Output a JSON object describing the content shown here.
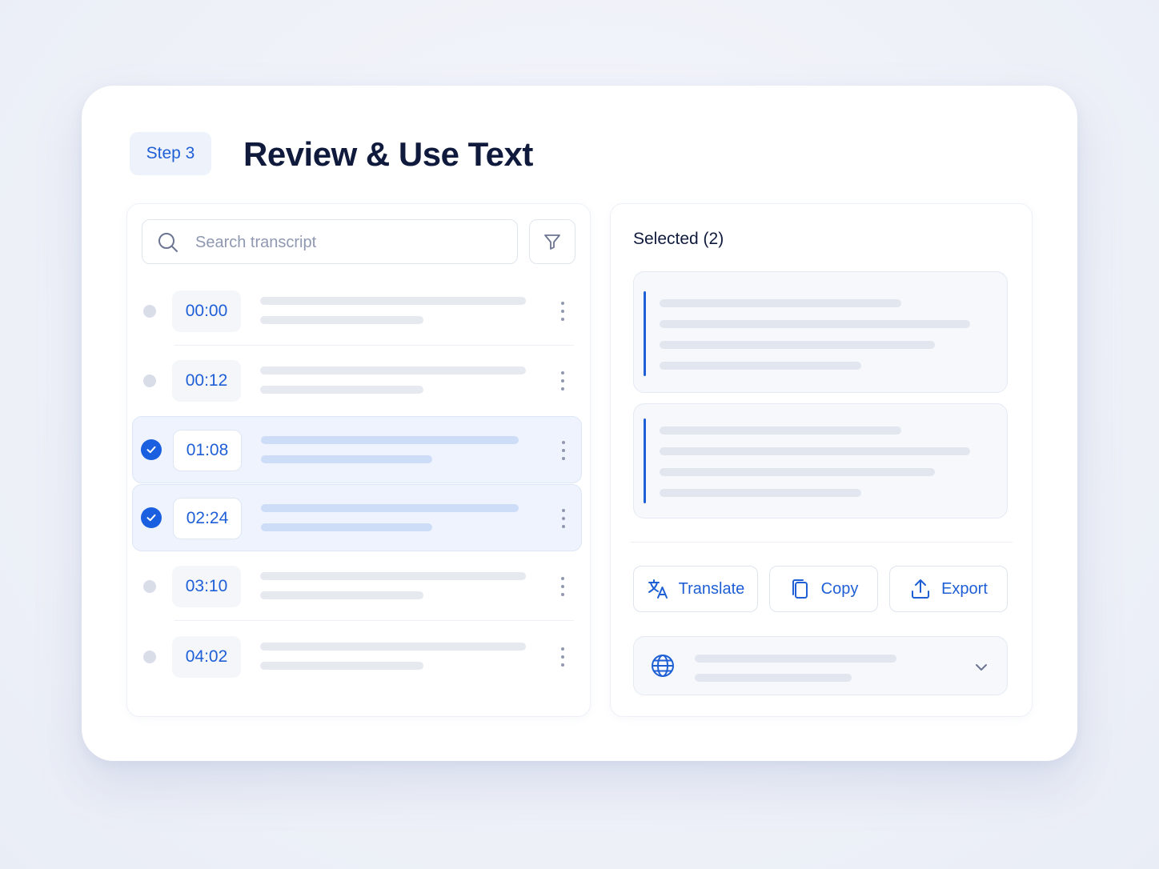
{
  "header": {
    "step_label": "Step 3",
    "title": "Review & Use Text"
  },
  "transcript": {
    "search_placeholder": "Search transcript",
    "rows": [
      {
        "time": "00:00",
        "selected": false
      },
      {
        "time": "00:12",
        "selected": false
      },
      {
        "time": "01:08",
        "selected": true
      },
      {
        "time": "02:24",
        "selected": true
      },
      {
        "time": "03:10",
        "selected": false
      },
      {
        "time": "04:02",
        "selected": false
      }
    ]
  },
  "selection": {
    "title": "Selected (2)"
  },
  "actions": {
    "translate_label": "Translate",
    "copy_label": "Copy",
    "export_label": "Export"
  },
  "colors": {
    "accent": "#1f5fd6",
    "title": "#0f1a3c",
    "selected_row_bg": "#eef3fd"
  },
  "icons": [
    "search-icon",
    "filter-icon",
    "check-icon",
    "more-vertical-icon",
    "translate-icon",
    "copy-icon",
    "export-icon",
    "globe-icon",
    "chevron-down-icon"
  ]
}
